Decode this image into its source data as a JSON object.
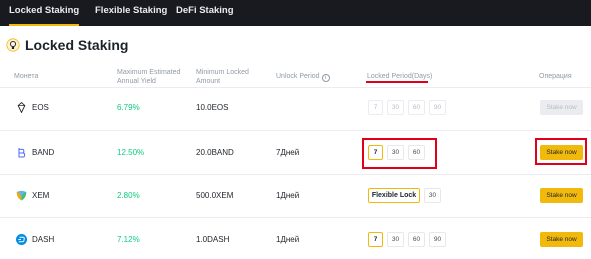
{
  "nav": {
    "tabs": [
      {
        "label": "Locked Staking",
        "active": true
      },
      {
        "label": "Flexible Staking",
        "active": false
      },
      {
        "label": "DeFi Staking",
        "active": false
      }
    ]
  },
  "page": {
    "title": "Locked Staking",
    "icon": "lightbulb-icon"
  },
  "table": {
    "headers": {
      "coin": "Монета",
      "yield": "Maximum Estimated Annual Yield",
      "min_locked": "Minimum Locked Amount",
      "unlock": "Unlock Period",
      "locked_period": "Locked Period(Days)",
      "operation": "Операция"
    },
    "rows": [
      {
        "coin": "EOS",
        "icon": "eos-icon",
        "yield": "6.79%",
        "min": "10.0EOS",
        "unlock": "",
        "periods": [
          {
            "label": "7"
          },
          {
            "label": "30"
          },
          {
            "label": "60"
          },
          {
            "label": "90"
          }
        ],
        "stake": "Stake now"
      },
      {
        "coin": "BAND",
        "icon": "band-icon",
        "yield": "12.50%",
        "min": "20.0BAND",
        "unlock": "7Дней",
        "periods": [
          {
            "label": "7"
          },
          {
            "label": "30"
          },
          {
            "label": "60"
          }
        ],
        "stake": "Stake now"
      },
      {
        "coin": "XEM",
        "icon": "xem-icon",
        "yield": "2.80%",
        "min": "500.0XEM",
        "unlock": "1Дней",
        "periods": [
          {
            "label": "Flexible Lock"
          },
          {
            "label": "30"
          }
        ],
        "stake": "Stake now"
      },
      {
        "coin": "DASH",
        "icon": "dash-icon",
        "yield": "7.12%",
        "min": "1.0DASH",
        "unlock": "1Дней",
        "periods": [
          {
            "label": "7"
          },
          {
            "label": "30"
          },
          {
            "label": "60"
          },
          {
            "label": "90"
          }
        ],
        "stake": "Stake now"
      }
    ]
  },
  "colors": {
    "accent": "#f0b90b",
    "yield": "#0ecb81",
    "highlight": "#e0001a",
    "nav_bg": "#181a20"
  }
}
